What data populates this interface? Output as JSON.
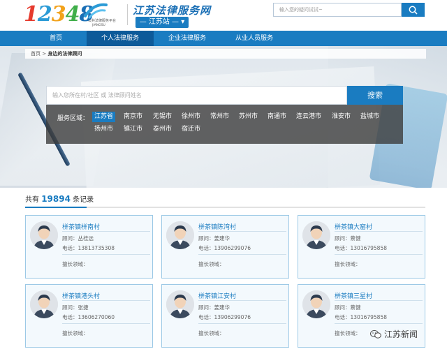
{
  "header": {
    "logo_number": "12348",
    "logo_sub_line1": "公共法律服务平台",
    "logo_sub_line2": "JIANGSU",
    "site_title": "江苏法律服务网",
    "station": "— 江苏站 —",
    "search_placeholder": "输入您的疑问试试~"
  },
  "nav": {
    "items": [
      "首页",
      "个人法律服务",
      "企业法律服务",
      "从业人员服务"
    ],
    "active_index": 1
  },
  "breadcrumb": {
    "home": "首页",
    "separator": ">",
    "current": "身边的法律顾问"
  },
  "search": {
    "placeholder": "输入您所在村/社区 或 法律顾问姓名",
    "button": "搜索"
  },
  "regions": {
    "label": "服务区域：",
    "row1": [
      "江苏省",
      "南京市",
      "无锡市",
      "徐州市",
      "常州市",
      "苏州市",
      "南通市",
      "连云港市",
      "淮安市",
      "盐城市"
    ],
    "row2": [
      "扬州市",
      "镇江市",
      "泰州市",
      "宿迁市"
    ],
    "active": "江苏省"
  },
  "results": {
    "prefix": "共有",
    "count": "19894",
    "suffix": "条记录"
  },
  "cards": [
    {
      "name": "栟茶镇栟南村",
      "advisor": "顾问：丛桂远",
      "phone": "电话：13813735308",
      "specialty": "擅长领域："
    },
    {
      "name": "栟茶镇陈湾村",
      "advisor": "顾问：姜建华",
      "phone": "电话：13906299076",
      "specialty": "擅长领域："
    },
    {
      "name": "栟茶镇大窑村",
      "advisor": "顾问：蔡健",
      "phone": "电话：13016795858",
      "specialty": "擅长领域："
    },
    {
      "name": "栟茶镇港头村",
      "advisor": "顾问：张捷",
      "phone": "电话：13606270060",
      "specialty": "擅长领域："
    },
    {
      "name": "栟茶镇江安村",
      "advisor": "顾问：姜建华",
      "phone": "电话：13906299076",
      "specialty": "擅长领域："
    },
    {
      "name": "栟茶镇三星村",
      "advisor": "顾问：蔡健",
      "phone": "电话：13016795858",
      "specialty": "擅长领域："
    }
  ],
  "watermark": "江苏新闻",
  "colors": {
    "primary": "#1a7cc1",
    "nav_active": "#0d5a99",
    "card_border": "#9cc9e6"
  }
}
